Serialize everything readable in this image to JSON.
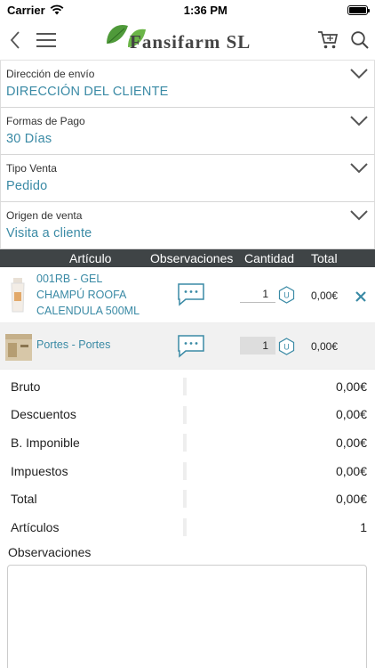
{
  "status_bar": {
    "carrier": "Carrier",
    "time": "1:36 PM"
  },
  "header": {
    "logo_text": "Fansifarm SL"
  },
  "fields": [
    {
      "label": "Dirección de envío",
      "value": "DIRECCIÓN DEL CLIENTE"
    },
    {
      "label": "Formas de Pago",
      "value": "30 Días"
    },
    {
      "label": "Tipo Venta",
      "value": "Pedido"
    },
    {
      "label": "Origen de venta",
      "value": "Visita a cliente"
    }
  ],
  "table": {
    "columns": [
      "Artículo",
      "Observaciones",
      "Cantidad",
      "Total"
    ],
    "lines": [
      {
        "name": "001RB - GEL CHAMPÚ ROOFA CALENDULA 500ML",
        "quantity": "1",
        "unit": "U",
        "total": "0,00€"
      },
      {
        "name": "Portes - Portes",
        "quantity": "1",
        "unit": "U",
        "total": "0,00€"
      }
    ]
  },
  "summary": [
    {
      "label": "Bruto",
      "value": "0,00€"
    },
    {
      "label": "Descuentos",
      "value": "0,00€"
    },
    {
      "label": "B. Imponible",
      "value": "0,00€"
    },
    {
      "label": "Impuestos",
      "value": "0,00€"
    },
    {
      "label": "Total",
      "value": "0,00€"
    },
    {
      "label": "Artículos",
      "value": "1"
    }
  ],
  "observations": {
    "label": "Observaciones"
  },
  "colors": {
    "accent": "#3a8aa5",
    "header_bg": "#3f4446"
  }
}
